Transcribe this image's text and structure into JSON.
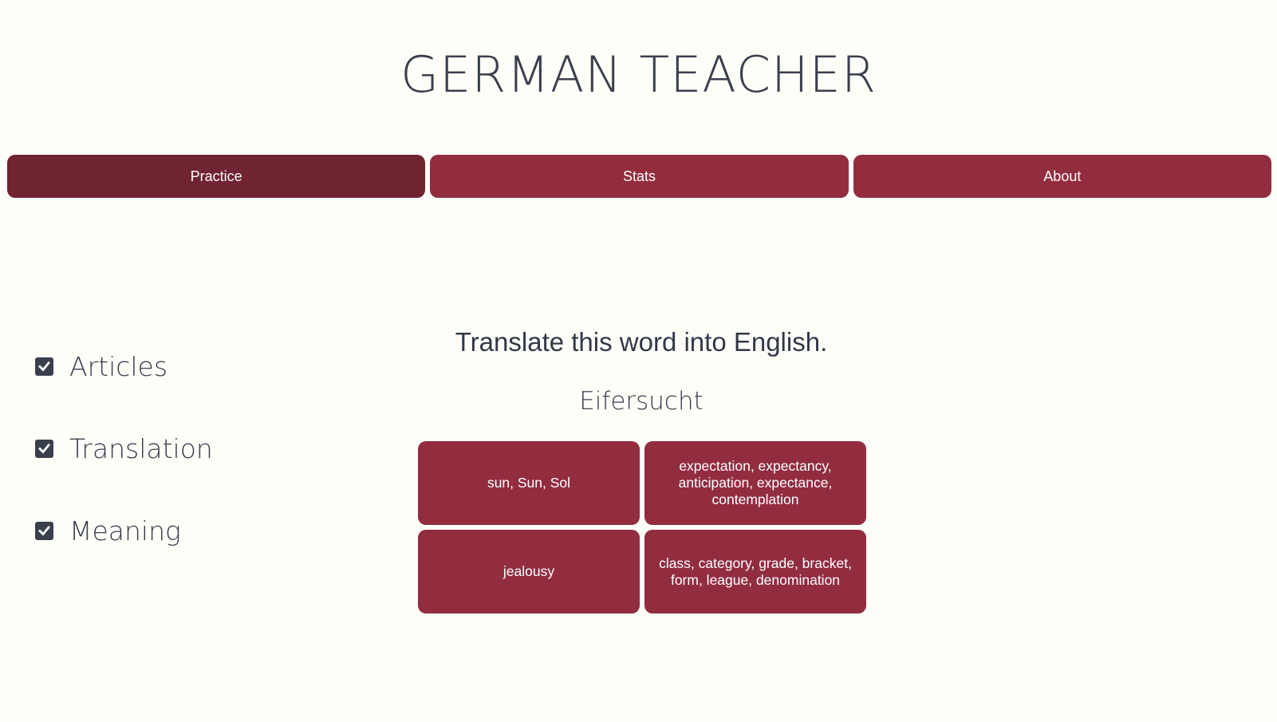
{
  "app": {
    "title": "GERMAN TEACHER"
  },
  "nav": {
    "tabs": [
      {
        "label": "Practice",
        "active": true
      },
      {
        "label": "Stats",
        "active": false
      },
      {
        "label": "About",
        "active": false
      }
    ]
  },
  "options": [
    {
      "label": "Articles",
      "checked": true
    },
    {
      "label": "Translation",
      "checked": true
    },
    {
      "label": "Meaning",
      "checked": true
    }
  ],
  "quiz": {
    "prompt": "Translate this word into English.",
    "word": "Eifersucht",
    "answers": [
      "sun, Sun, Sol",
      "expectation, expectancy, anticipation, expectance, contemplation",
      "jealousy",
      "class, category, grade, bracket, form, league, denomination"
    ]
  },
  "colors": {
    "background": "#fefef9",
    "accent": "#922d40",
    "accent_active": "#702330",
    "text": "#3a3f4c"
  },
  "icons": {
    "checkbox": "checkmark-icon"
  }
}
